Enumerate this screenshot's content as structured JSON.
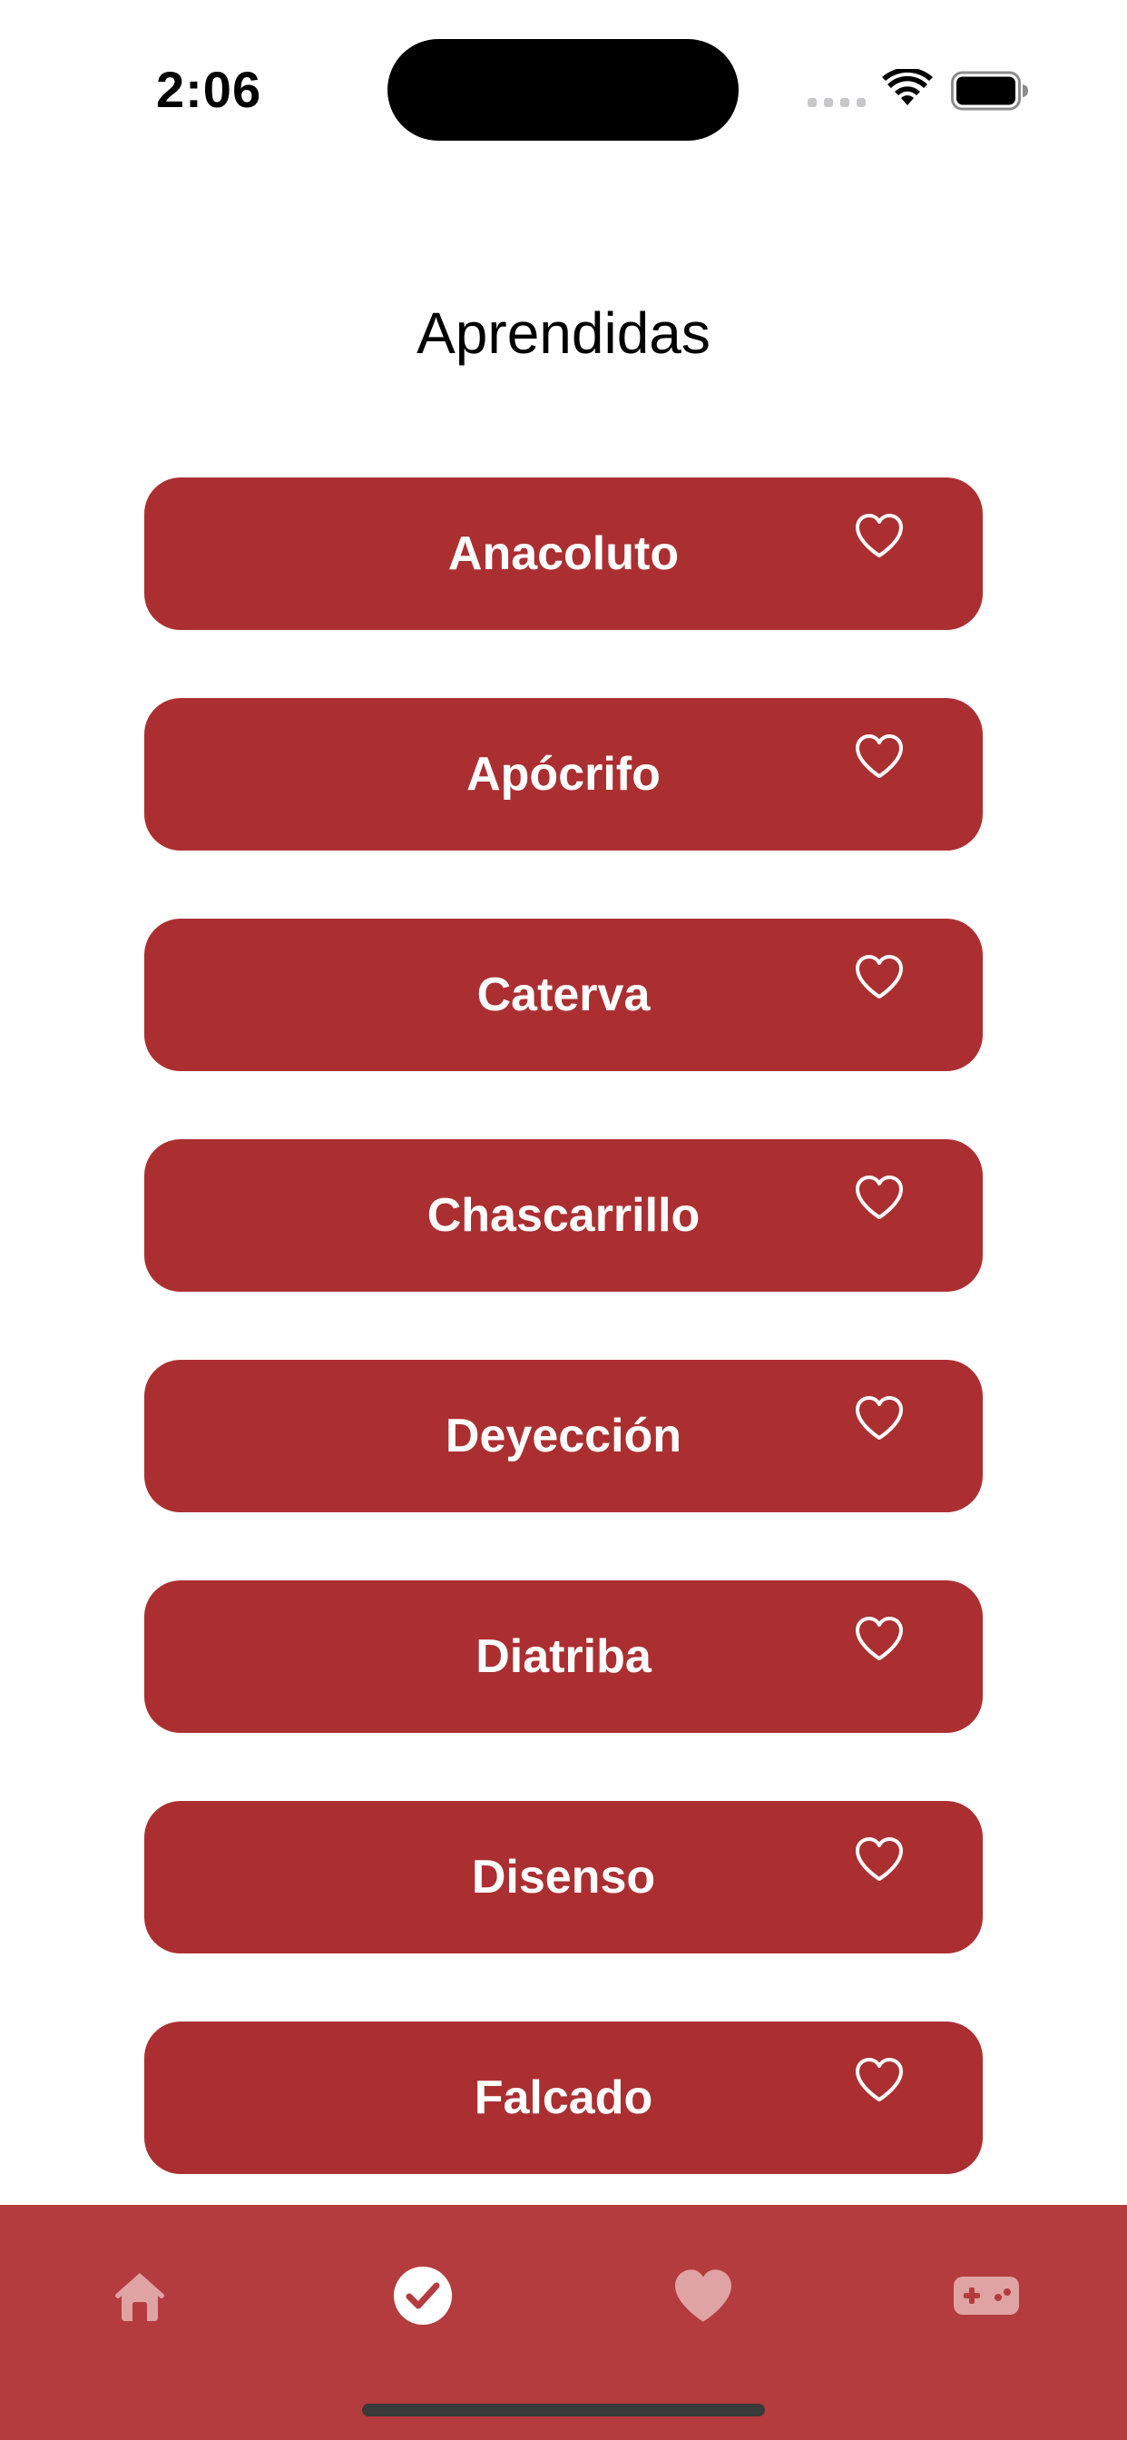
{
  "status_bar": {
    "time": "2:06",
    "icons": [
      "cellular-signal-icon",
      "wifi-icon",
      "battery-icon"
    ]
  },
  "page": {
    "title": "Aprendidas"
  },
  "words": [
    {
      "label": "Anacoluto",
      "icon": "heart-outline-icon"
    },
    {
      "label": "Apócrifo",
      "icon": "heart-outline-icon"
    },
    {
      "label": "Caterva",
      "icon": "heart-outline-icon"
    },
    {
      "label": "Chascarrillo",
      "icon": "heart-outline-icon"
    },
    {
      "label": "Deyección",
      "icon": "heart-outline-icon"
    },
    {
      "label": "Diatriba",
      "icon": "heart-outline-icon"
    },
    {
      "label": "Disenso",
      "icon": "heart-outline-icon"
    },
    {
      "label": "Falcado",
      "icon": "heart-outline-icon"
    }
  ],
  "tab_bar": {
    "tabs": [
      {
        "icon": "home-icon",
        "selected": false
      },
      {
        "icon": "checkmark-circle-icon",
        "selected": true
      },
      {
        "icon": "heart-icon",
        "selected": false
      },
      {
        "icon": "gamecontroller-icon",
        "selected": false
      }
    ]
  },
  "colors": {
    "accent": "#ab2e31",
    "tab_bar_background": "#b43c3e",
    "tab_selected": "#ffffff",
    "tab_unselected": "#e0a3a4",
    "text_on_accent": "#ffffff"
  }
}
